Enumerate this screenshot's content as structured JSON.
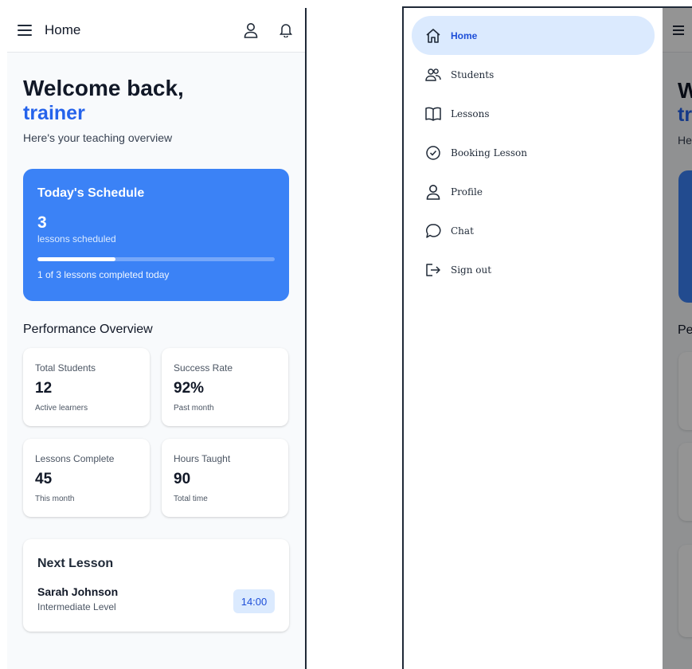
{
  "appbar": {
    "title": "Home",
    "menu_icon": "hamburger-icon",
    "profile_icon": "user-icon",
    "notifications_icon": "bell-icon"
  },
  "welcome": {
    "line1": "Welcome back,",
    "line2": "trainer",
    "subtitle": "Here's your teaching overview"
  },
  "schedule": {
    "title": "Today's Schedule",
    "count": "3",
    "count_label": "lessons scheduled",
    "progress_fraction": 0.33,
    "completed_text": "1 of 3 lessons completed today"
  },
  "performance": {
    "title": "Performance Overview",
    "cards": [
      {
        "title": "Total Students",
        "value": "12",
        "sub": "Active learners"
      },
      {
        "title": "Success Rate",
        "value": "92%",
        "sub": "Past month"
      },
      {
        "title": "Lessons Complete",
        "value": "45",
        "sub": "This month"
      },
      {
        "title": "Hours Taught",
        "value": "90",
        "sub": "Total time"
      }
    ]
  },
  "next_lesson": {
    "title": "Next Lesson",
    "student": "Sarah Johnson",
    "level": "Intermediate Level",
    "time": "14:00"
  },
  "drawer": {
    "items": [
      {
        "label": "Home",
        "icon": "home-icon",
        "active": true
      },
      {
        "label": "Students",
        "icon": "users-icon",
        "active": false
      },
      {
        "label": "Lessons",
        "icon": "book-icon",
        "active": false
      },
      {
        "label": "Booking Lesson",
        "icon": "check-circle-icon",
        "active": false
      },
      {
        "label": "Profile",
        "icon": "user-icon",
        "active": false
      },
      {
        "label": "Chat",
        "icon": "chat-icon",
        "active": false
      },
      {
        "label": "Sign out",
        "icon": "sign-out-icon",
        "active": false
      }
    ]
  },
  "colors": {
    "accent": "#3b82f6",
    "accent_dark": "#2563eb",
    "active_nav_bg": "#dbeafe",
    "background": "#f8fafc"
  }
}
